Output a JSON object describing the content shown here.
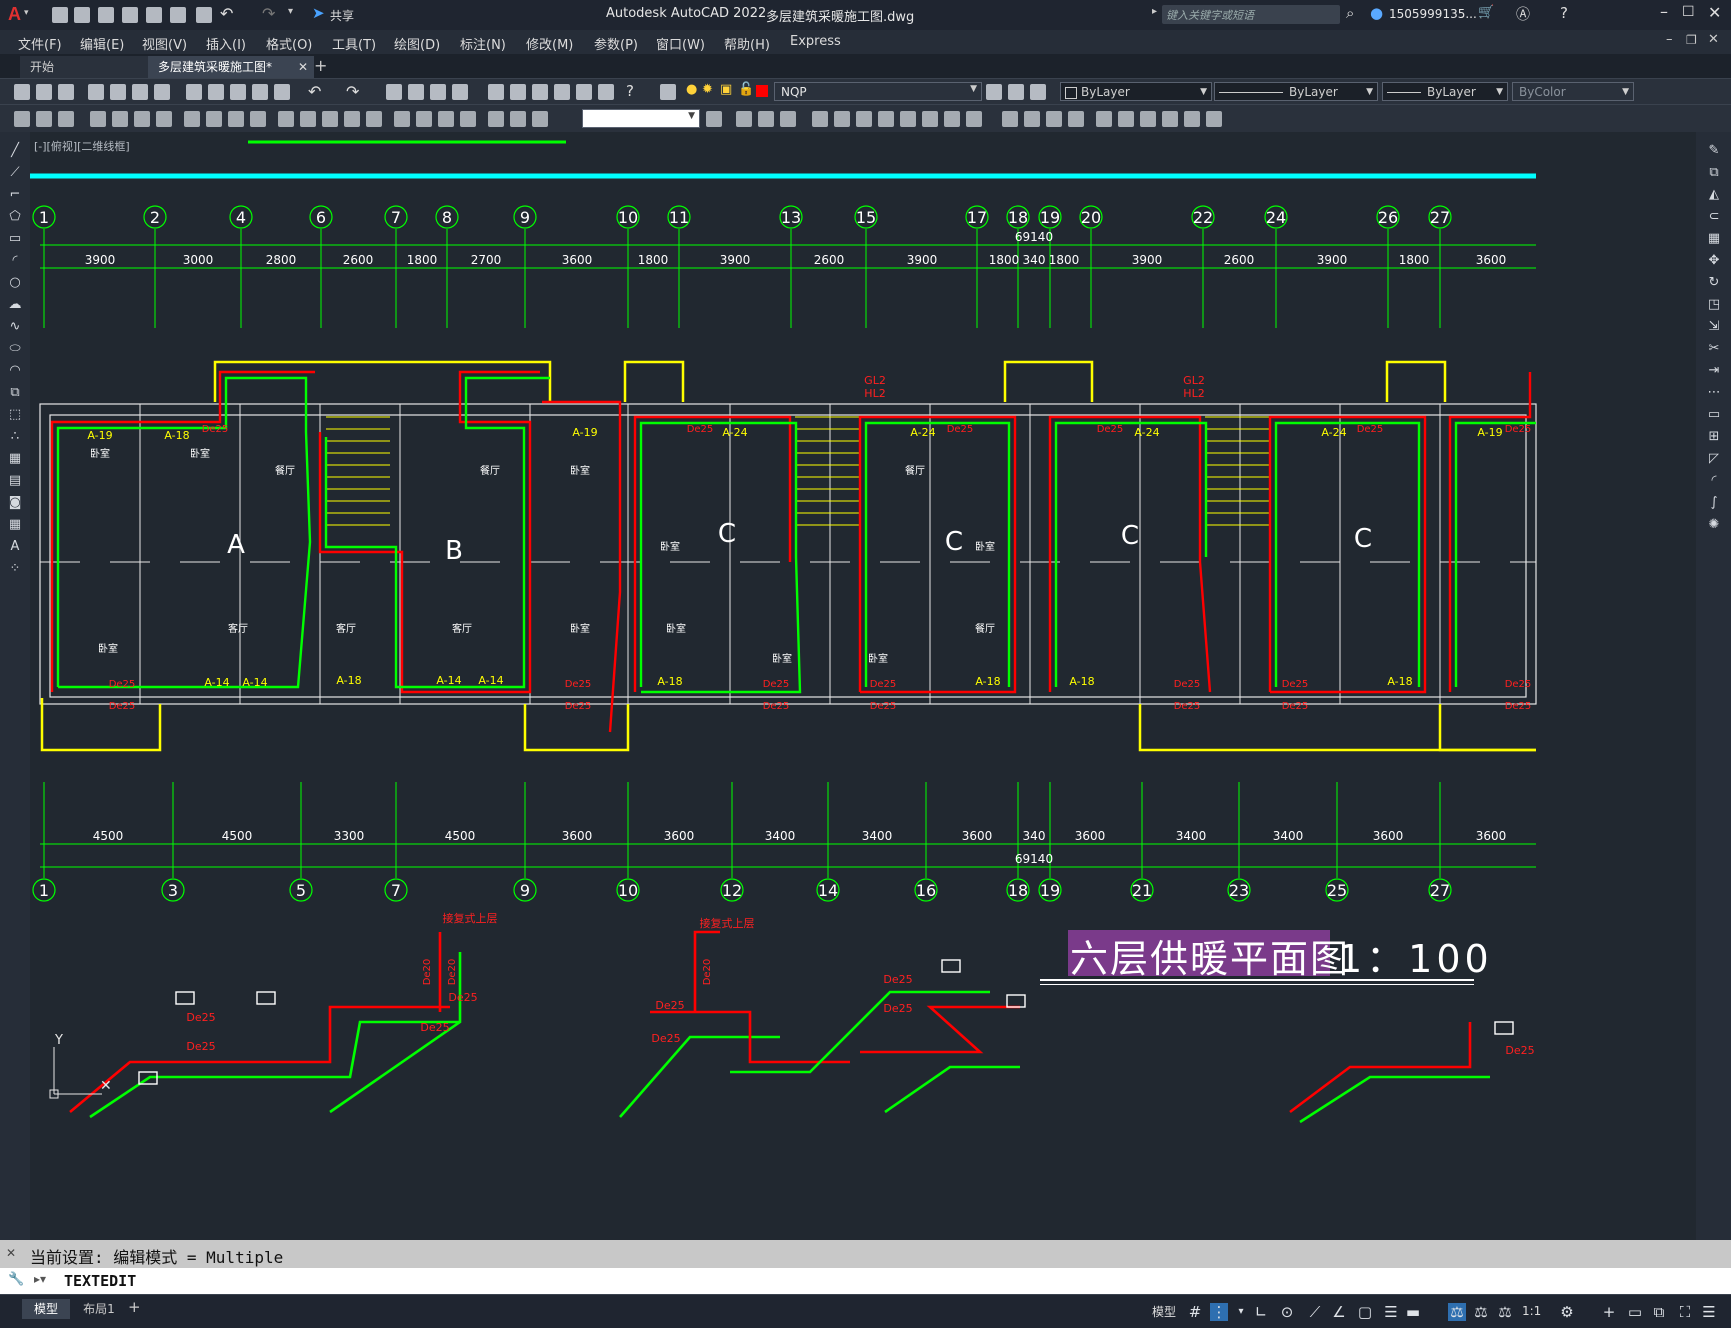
{
  "app": {
    "title": "Autodesk AutoCAD 2022",
    "document": "多层建筑采暖施工图.dwg",
    "share_label": "共享",
    "search_placeholder": "键入关键字或短语",
    "user": "1505999135...",
    "window_controls": [
      "minimize-icon",
      "maximize-icon",
      "close-icon"
    ]
  },
  "menu": [
    "文件(F)",
    "编辑(E)",
    "视图(V)",
    "插入(I)",
    "格式(O)",
    "工具(T)",
    "绘图(D)",
    "标注(N)",
    "修改(M)",
    "参数(P)",
    "窗口(W)",
    "帮助(H)",
    "Express"
  ],
  "tabs": [
    {
      "label": "开始",
      "active": false
    },
    {
      "label": "多层建筑采暖施工图*",
      "active": true
    }
  ],
  "layer_bar": {
    "layer": "NQP",
    "color": "ByLayer",
    "linetype": "ByLayer",
    "lineweight": "ByLayer",
    "plotstyle": "ByColor"
  },
  "viewport_label": "[-][俯视][二维线框]",
  "drawing": {
    "top_axes": [
      "1",
      "2",
      "4",
      "6",
      "7",
      "8",
      "9",
      "10",
      "11",
      "13",
      "15",
      "17",
      "18",
      "19",
      "20",
      "22",
      "24",
      "26",
      "27"
    ],
    "top_dims": [
      "3900",
      "3000",
      "2800",
      "2600",
      "1800",
      "2700",
      "3600",
      "1800",
      "3900",
      "2600",
      "3900",
      "1800",
      "340",
      "1800",
      "3900",
      "2600",
      "3900",
      "1800",
      "3600"
    ],
    "top_total": "69140",
    "bottom_axes": [
      "1",
      "3",
      "5",
      "7",
      "9",
      "10",
      "12",
      "14",
      "16",
      "18",
      "19",
      "21",
      "23",
      "25",
      "27"
    ],
    "bottom_dims": [
      "4500",
      "4500",
      "3300",
      "4500",
      "3600",
      "3600",
      "3400",
      "3400",
      "3600",
      "340",
      "3600",
      "3400",
      "3400",
      "3600",
      "3600"
    ],
    "bottom_total": "69140",
    "units": [
      "A",
      "B",
      "C",
      "C",
      "C",
      "C"
    ],
    "rooms": [
      "卧室",
      "卧室",
      "餐厅",
      "餐厅",
      "卧室",
      "客厅",
      "客厅",
      "客厅",
      "卧室",
      "卧室",
      "卧室",
      "卧室",
      "卧室",
      "餐厅",
      "餐厅",
      "卧室",
      "卧室"
    ],
    "radiators": [
      "A-19",
      "A-18",
      "A-14",
      "A-14",
      "A-18",
      "A-14",
      "A-14",
      "A-19",
      "A-24",
      "A-24",
      "A-18",
      "A-18",
      "A-24",
      "A-24",
      "A-18",
      "A-18",
      "A-19"
    ],
    "pipe_labels": [
      "De25",
      "GL2",
      "HL2",
      "De20"
    ],
    "riser_note": "接复式上层",
    "plan_title": "六层供暖平面图",
    "plan_scale": "1：100",
    "ucs_y": "Y"
  },
  "command": {
    "history": "当前设置: 编辑模式 = Multiple",
    "input": "TEXTEDIT"
  },
  "status": {
    "model_tab": "模型",
    "layout_tab": "布局1",
    "space": "模型",
    "scale": "1:1"
  }
}
